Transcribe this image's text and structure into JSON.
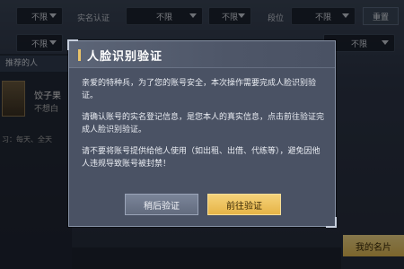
{
  "filters": {
    "row1": [
      {
        "label": "不限"
      },
      {
        "label": "实名认证"
      },
      {
        "label": "不限"
      },
      {
        "label": "段位"
      },
      {
        "label": "不限"
      }
    ],
    "row2": [
      {
        "label": "不限"
      },
      {
        "label": "不限"
      },
      {
        "label": "不限"
      }
    ],
    "reset_label": "重置"
  },
  "left_panel": {
    "header": "推荐的人",
    "player_name": "饺子果",
    "player_meta": "不想白",
    "player_tags": "习：每天、全天"
  },
  "my_card_label": "我的名片",
  "dialog": {
    "title": "人脸识别验证",
    "paragraphs": [
      "亲爱的特种兵，为了您的账号安全，本次操作需要完成人脸识别验证。",
      "请确认账号的实名登记信息，是您本人的真实信息，点击前往验证完成人脸识别验证。",
      "请不要将账号提供给他人使用（如出租、出借、代练等），避免因他人违规导致账号被封禁！"
    ],
    "later_label": "稍后验证",
    "go_label": "前往验证"
  }
}
